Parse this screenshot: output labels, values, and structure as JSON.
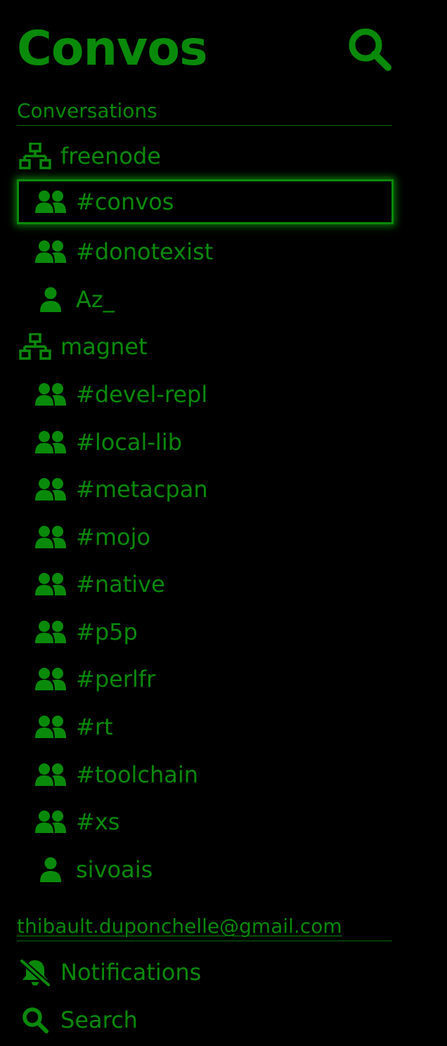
{
  "app": {
    "title": "Convos"
  },
  "header": {
    "search_icon": "search-icon"
  },
  "conversations": {
    "heading": "Conversations",
    "connections": [
      {
        "name": "freenode",
        "icon": "network-icon",
        "items": [
          {
            "name": "#convos",
            "type": "channel",
            "icon": "users-icon",
            "active": true
          },
          {
            "name": "#donotexist",
            "type": "channel",
            "icon": "users-icon"
          },
          {
            "name": "Az_",
            "type": "private",
            "icon": "user-icon"
          }
        ]
      },
      {
        "name": "magnet",
        "icon": "network-icon",
        "items": [
          {
            "name": "#devel-repl",
            "type": "channel",
            "icon": "users-icon"
          },
          {
            "name": "#local-lib",
            "type": "channel",
            "icon": "users-icon"
          },
          {
            "name": "#metacpan",
            "type": "channel",
            "icon": "users-icon"
          },
          {
            "name": "#mojo",
            "type": "channel",
            "icon": "users-icon"
          },
          {
            "name": "#native",
            "type": "channel",
            "icon": "users-icon"
          },
          {
            "name": "#p5p",
            "type": "channel",
            "icon": "users-icon"
          },
          {
            "name": "#perlfr",
            "type": "channel",
            "icon": "users-icon"
          },
          {
            "name": "#rt",
            "type": "channel",
            "icon": "users-icon"
          },
          {
            "name": "#toolchain",
            "type": "channel",
            "icon": "users-icon"
          },
          {
            "name": "#xs",
            "type": "channel",
            "icon": "users-icon"
          },
          {
            "name": "sivoais",
            "type": "private",
            "icon": "user-icon"
          }
        ]
      }
    ]
  },
  "user": {
    "email": "thibault.duponchelle@gmail.com",
    "menu": [
      {
        "label": "Notifications",
        "icon": "bell-slash-icon"
      },
      {
        "label": "Search",
        "icon": "search-icon"
      }
    ]
  },
  "colors": {
    "background": "#000000",
    "accent": "#0a8a0a",
    "active_glow": "#14c814"
  }
}
